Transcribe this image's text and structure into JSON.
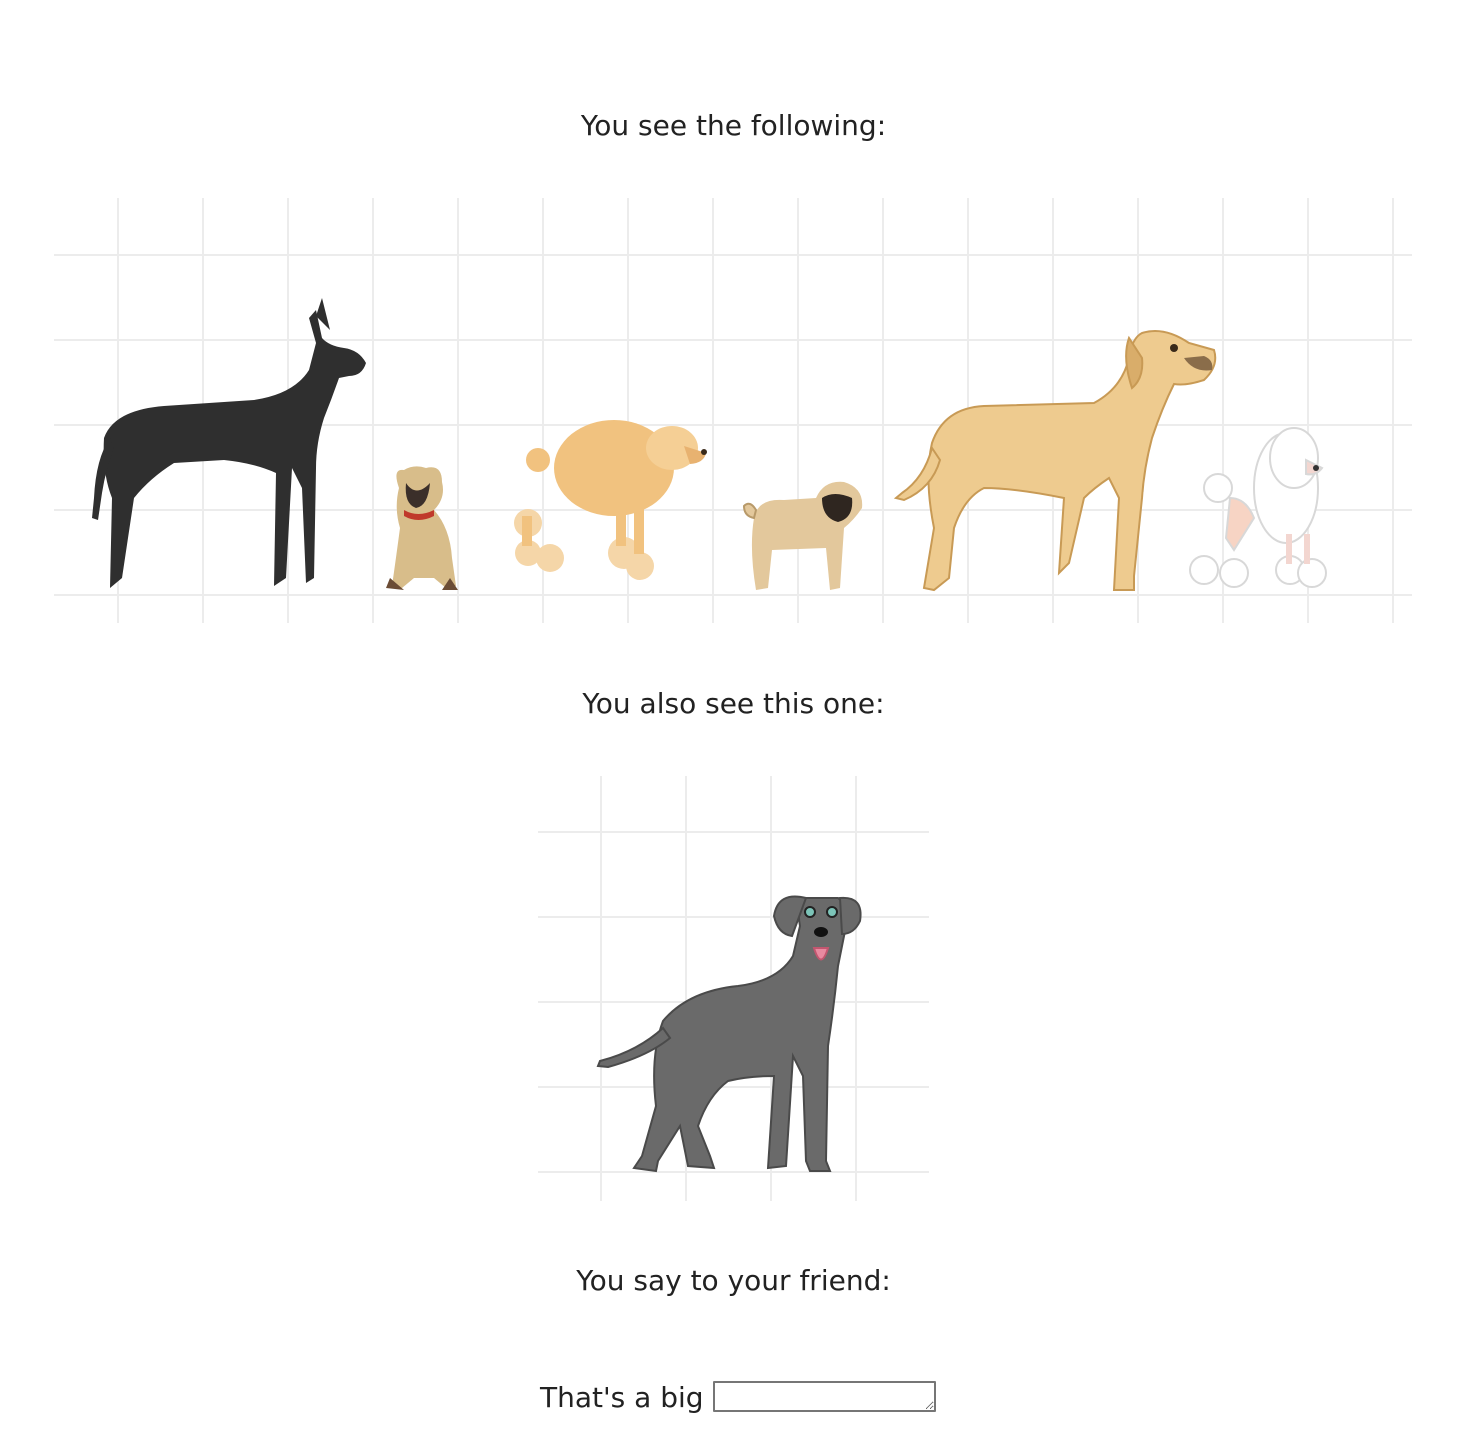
{
  "prompts": {
    "first": "You see the following:",
    "second": "You also see this one:",
    "third": "You say to your friend:"
  },
  "answer": {
    "label": "That's a big",
    "value": ""
  },
  "lineup": {
    "dogs": [
      {
        "breed": "great-dane",
        "color": "#2f2f2f"
      },
      {
        "breed": "pug",
        "color": "#d8bd8a"
      },
      {
        "breed": "poodle",
        "color": "#f1c27f"
      },
      {
        "breed": "pug",
        "color": "#e3c89c"
      },
      {
        "breed": "great-dane",
        "color": "#eecb8f"
      },
      {
        "breed": "poodle",
        "color": "#ffffff"
      }
    ]
  },
  "target": {
    "breed": "great-dane",
    "color": "#6a6a6a"
  }
}
